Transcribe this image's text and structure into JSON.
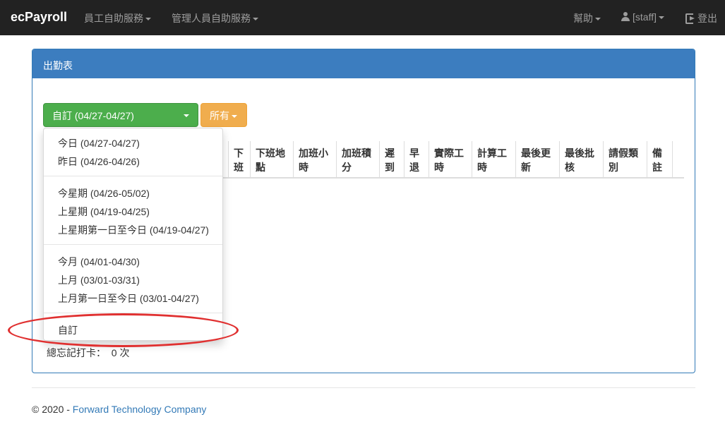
{
  "navbar": {
    "brand": "ecPayroll",
    "menu_employee": "員工自助服務",
    "menu_manager": "管理人員自助服務",
    "help": "幫助",
    "user": "[staff]",
    "logout": "登出"
  },
  "panel": {
    "title": "出勤表",
    "range_button": "自訂 (04/27-04/27)",
    "filter_button": "所有"
  },
  "table": {
    "headers": [
      "下班",
      "下班地點",
      "加班小時",
      "加班積分",
      "遲到",
      "早退",
      "實際工時",
      "計算工時",
      "最後更新",
      "最後批核",
      "請假類別",
      "備註"
    ]
  },
  "summary": {
    "label": "總忘記打卡：",
    "value": "0 次"
  },
  "dropdown": {
    "items": [
      "今日 (04/27-04/27)",
      "昨日 (04/26-04/26)",
      "今星期 (04/26-05/02)",
      "上星期 (04/19-04/25)",
      "上星期第一日至今日 (04/19-04/27)",
      "今月 (04/01-04/30)",
      "上月 (03/01-03/31)",
      "上月第一日至今日 (03/01-04/27)",
      "自訂"
    ]
  },
  "footer": {
    "copyright": "© 2020 - ",
    "company": "Forward Technology Company"
  },
  "colors": {
    "navbar_bg": "#222222",
    "panel_primary": "#3c7dbf",
    "button_success": "#4cae4c",
    "button_warning": "#f0ad4e",
    "highlight_annotation": "#e03030",
    "link": "#337ab7"
  }
}
